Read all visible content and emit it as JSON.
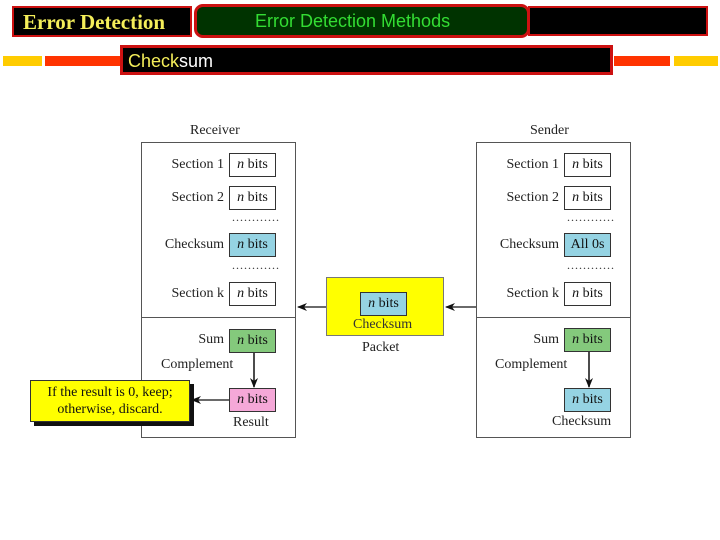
{
  "header": {
    "title": "Error Detection",
    "section_tab": "Error Detection Methods",
    "subtitle_highlight": "Check",
    "subtitle_rest": "sum"
  },
  "colors": {
    "title_bg": "#000000",
    "border_red": "#cc1111",
    "title_text": "#f4ee5a",
    "tab_bg": "#003300",
    "tab_text": "#33dd33",
    "accent_red": "#ff3300",
    "accent_yellow": "#ffcc00",
    "checksum_blue": "#95d3e3",
    "sum_green": "#84c97c",
    "result_pink": "#f5a8d8",
    "packet_yellow": "#ffff00"
  },
  "diagram": {
    "receiver": {
      "title": "Receiver",
      "rows": [
        {
          "label": "Section 1",
          "value_italic": "n",
          "value": " bits"
        },
        {
          "label": "Section 2",
          "value_italic": "n",
          "value": " bits"
        },
        {
          "label": "Checksum",
          "value_italic": "n",
          "value": " bits"
        },
        {
          "label": "Section k",
          "value_italic": "n",
          "value": " bits"
        }
      ],
      "sum_label": "Sum",
      "sum_value_italic": "n",
      "sum_value": " bits",
      "complement_label": "Complement",
      "result_value_italic": "n",
      "result_value": " bits",
      "result_label": "Result",
      "dots": "............"
    },
    "sender": {
      "title": "Sender",
      "rows": [
        {
          "label": "Section 1",
          "value_italic": "n",
          "value": " bits"
        },
        {
          "label": "Section 2",
          "value_italic": "n",
          "value": " bits"
        },
        {
          "label": "Checksum",
          "value_italic": "",
          "value": "All 0s"
        },
        {
          "label": "Section k",
          "value_italic": "n",
          "value": " bits"
        }
      ],
      "sum_label": "Sum",
      "sum_value_italic": "n",
      "sum_value": " bits",
      "complement_label": "Complement",
      "checksum_value_italic": "n",
      "checksum_value": " bits",
      "checksum_label": "Checksum",
      "dots": "............"
    },
    "packet": {
      "value_italic": "n",
      "value": " bits",
      "inner_label": "Checksum",
      "caption": "Packet"
    },
    "decision": {
      "line1": "If the result is 0, keep;",
      "line2": "otherwise, discard."
    }
  }
}
